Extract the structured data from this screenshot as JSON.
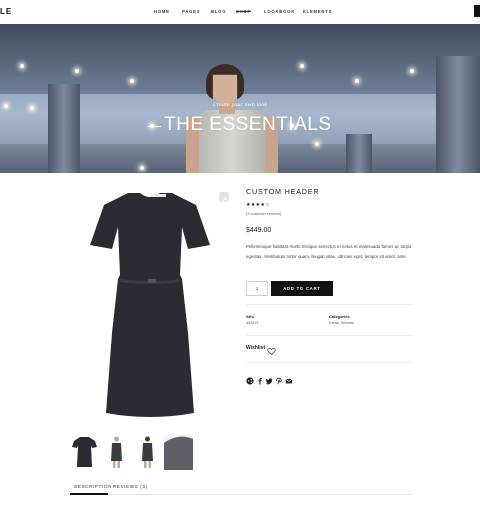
{
  "header": {
    "logo": "LE",
    "nav": [
      "HOME",
      "PAGES",
      "BLOG",
      "SHOP",
      "LOOKBOOK",
      "ELEMENTS"
    ],
    "active": "SHOP"
  },
  "hero": {
    "tagline": "Create your own look",
    "title": "THE ESSENTIALS"
  },
  "product": {
    "title": "CUSTOM HEADER",
    "rating": 4,
    "rating_max": 5,
    "stars_display": "★★★★☆",
    "reviews_text": "(3 customer reviews)",
    "price": "$449.00",
    "description": "Pellentesque habitant morbi tristique senectus et netus et malesuada fames ac turpis egestas. Vestibulum tortor quam, feugiat vitae, ultricies eget, tempor sit amet, ante.",
    "quantity": "1",
    "add_to_cart": "ADD TO CART",
    "meta": {
      "sku_label": "SKU",
      "sku_value": "432671",
      "categories_label": "Categories",
      "categories_value": "Dress, Women"
    },
    "wishlist_label": "Wishlist",
    "share_icons": [
      "share-icon",
      "facebook-icon",
      "twitter-icon",
      "pinterest-icon",
      "email-icon"
    ]
  },
  "gallery": {
    "thumbnails": [
      "dress-thumbnail",
      "model-front-thumbnail",
      "model-back-thumbnail",
      "fabric-detail-thumbnail"
    ]
  },
  "tabs": [
    "DESCRIPTION",
    "REVIEWS (3)"
  ],
  "active_tab": "DESCRIPTION",
  "colors": {
    "accent": "#111111",
    "dress": "#2a2c33",
    "hero_sky": "#8da0bb"
  }
}
